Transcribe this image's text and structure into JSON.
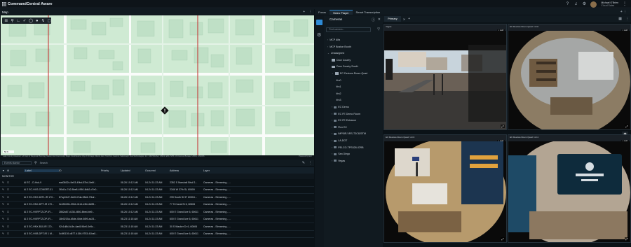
{
  "app": {
    "title": "CommandCentral Aware"
  },
  "user": {
    "name": "Michael O'Brien",
    "org": "Cloud Sales",
    "initials": "MO"
  },
  "map_pane": {
    "tab": "Map",
    "attribution": "Lake County Assessor, LA Dept of Regional Planning, Maxar, Esri Community Maps Contributors, City of Chicago, Illinois, Esri, TomTom, Garmin, SafeGraph, GeoTechnologies, Inc., METI/NASA, USGS, EPA, NPS, US Census Bureau, USDA, USFWS",
    "powered_by": "Powered by Esri",
    "scale_label": "50 ft"
  },
  "events": {
    "selector": "Events stantor",
    "search_placeholder": "Search",
    "columns": [
      "Label",
      "ID",
      "Priority",
      "Updated",
      "Occurred",
      "Address",
      "Layer"
    ],
    "monitor_label": "MONITOR",
    "rows": [
      {
        "label": "AI EC - D-Hck-9",
        "id": "ead3602c-9e03-49bd-87b4-5e6f...",
        "priority": "",
        "updated": "08-26 10:12 AM",
        "occurred": "04-24 11:23 AM",
        "address": "2352 S Marshall Blvd S...",
        "layer": "Cameras - Streaming - ..."
      },
      {
        "label": "AI 2 EC-HXS-CONSRT-01",
        "id": "3f0d1c-7d2-8be8-4950-8db2-d7e0...",
        "priority": "",
        "updated": "08-26 10:12 AM",
        "occurred": "04-24 11:23 AM",
        "address": "2346 W 37th St, 60609",
        "layer": "Cameras - Streaming - ..."
      },
      {
        "label": "AI 2 EC-HKX-MIT1-IR 170...",
        "id": "87ap02d7-9a9f-47da-98d4-7f1af...",
        "priority": "",
        "updated": "08-26 10:12 AM",
        "occurred": "04-24 11:23 AM",
        "address": "299 South St 97 60304...",
        "layer": "Cameras - Streaming - ..."
      },
      {
        "label": "AI 2 EC-HNX-DPT-IR 170...",
        "id": "0e45049b-2964-4114-b3fe-6dff8...",
        "priority": "",
        "updated": "08-26 10:12 AM",
        "occurred": "04-24 11:23 AM",
        "address": "77 S Canal St 6, 60606",
        "layer": "Cameras - Streaming - ..."
      },
      {
        "label": "AI 2 EC-HXRPTZ-DP-IR...",
        "id": "2862a67-d138-4650-8bed-bb9...",
        "priority": "",
        "updated": "08-26 10:12 AM",
        "occurred": "04-24 11:23 AM",
        "address": "600 E Grand Ave 6, 60611",
        "layer": "Cameras - Streaming - ..."
      },
      {
        "label": "AI 2 EC-HXRPTZ-DP-IR...",
        "id": "18e0215a-d5de-40de-8f09-ac24...",
        "priority": "",
        "updated": "08-23 11:18 AM",
        "occurred": "04-24 11:23 AM",
        "address": "600 E Grand Ave 6, 60611",
        "layer": "Cameras - Streaming - ..."
      },
      {
        "label": "AI 3 EC-HNX-B10-IR 170...",
        "id": "92c1d8d-4c3e-4ae8-96e0-0e5c...",
        "priority": "",
        "updated": "08-23 11:18 AM",
        "occurred": "04-24 11:23 AM",
        "address": "30 S Wacker Dr 6, 60606",
        "layer": "Cameras - Streaming - ..."
      },
      {
        "label": "AI 3 EC-HXB-DPT-IR 1 M...",
        "id": "0c5f0139-d677-4156-9753-41ba0...",
        "priority": "",
        "updated": "08-23 11:18 AM",
        "occurred": "04-24 11:23 AM",
        "address": "600 E Grand Ave 6, 60611",
        "layer": "Cameras - Streaming - ..."
      }
    ]
  },
  "middle_tabs": [
    "Focus",
    "Video Player",
    "Smart Transcription"
  ],
  "middle_active_tab": "Video Player",
  "cameras": {
    "title": "Cameras",
    "search_placeholder": "Find camera...",
    "tree": [
      {
        "label": "MCP Alfa",
        "level": 0,
        "kind": "group"
      },
      {
        "label": "MCP Boston Booth",
        "level": 0,
        "kind": "group"
      },
      {
        "label": "Unassigned",
        "level": 0,
        "kind": "group-open"
      },
      {
        "label": "Door County",
        "level": 1,
        "kind": "folder"
      },
      {
        "label": "Door County South",
        "level": 1,
        "kind": "folder"
      },
      {
        "label": "EC Devices Room Quad",
        "level": 1,
        "kind": "folder-open"
      },
      {
        "label": "Vrn0",
        "level": 2,
        "kind": "plain"
      },
      {
        "label": "Vrn1",
        "level": 2,
        "kind": "plain"
      },
      {
        "label": "Vrn2",
        "level": 2,
        "kind": "plain"
      },
      {
        "label": "Vrn3",
        "level": 2,
        "kind": "plain"
      },
      {
        "label": "EC Demo",
        "level": 1,
        "kind": "camera"
      },
      {
        "label": "EC FE Demo Room",
        "level": 1,
        "kind": "camera"
      },
      {
        "label": "EC FE Entrance",
        "level": 1,
        "kind": "camera"
      },
      {
        "label": "Flex EC",
        "level": 1,
        "kind": "camera"
      },
      {
        "label": "IMP5IR-VRS-T3C820TM",
        "level": 1,
        "kind": "camera"
      },
      {
        "label": "LA-DOT",
        "level": 1,
        "kind": "camera"
      },
      {
        "label": "PELCO-TPS528-IORB",
        "level": 1,
        "kind": "camera"
      },
      {
        "label": "San Diego",
        "level": 1,
        "kind": "camera"
      },
      {
        "label": "Vegas",
        "level": 1,
        "kind": "camera"
      }
    ]
  },
  "video_player": {
    "tab": "Primary",
    "tiles": [
      {
        "label": "Vegas",
        "live": "LIVE"
      },
      {
        "label": "EC Devices Room Quad / vrn0",
        "live": "LIVE"
      },
      {
        "label": "EC Devices Room Quad / vrn3",
        "live": "LIVE"
      },
      {
        "label": "EC Devices Room Quad / vrn1",
        "live": "LIVE"
      }
    ]
  },
  "icons": {
    "apps": "grid-icon",
    "help": "help-icon",
    "notifications": "bell-icon",
    "settings": "gear-icon",
    "close": "close-icon",
    "add": "plus-icon",
    "more": "more-icon",
    "filter": "filter-icon",
    "expand": "expand-icon",
    "incident": "incident-marker-icon"
  },
  "colors": {
    "accent": "#2e8bd6",
    "map_bg": "#cfead3",
    "map_road": "#c62828",
    "building": "#b9dcc1",
    "panel": "#111a20",
    "app_bg": "#0b1217"
  }
}
